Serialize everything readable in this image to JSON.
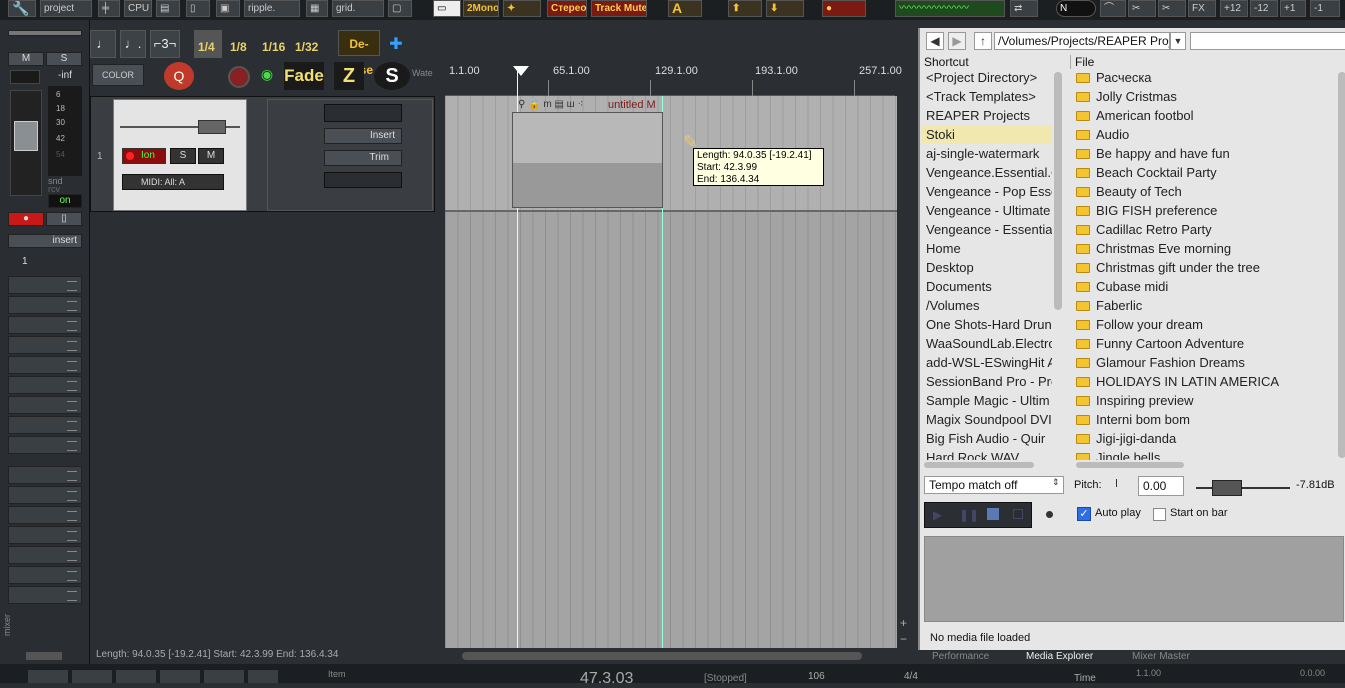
{
  "toolbar_top": {
    "project_label": "project",
    "cpu_label": "CPU",
    "ripple_label": "ripple.",
    "grid_label": "grid.",
    "mono_label": "2Mono",
    "stereo_label": "Стерео",
    "track_label": "Track Mute",
    "fx_label": "FX",
    "values": [
      "+12",
      "-12",
      "+1",
      "-1"
    ]
  },
  "mixer": {
    "m_label": "M",
    "s_label": "S",
    "inf_label": "-inf",
    "scale": [
      "6",
      "18",
      "30",
      "42",
      "54"
    ],
    "snd_label": "snd",
    "rcv_label": "rcv",
    "on_label": "on",
    "insert_label": "insert",
    "track_number": "1",
    "side_label": "mixer"
  },
  "grid_toolbar": {
    "divisions": [
      "1/4",
      "1/8",
      "1/16",
      "1/32"
    ],
    "deesser_label": "De-Esse",
    "color_label": "COLOR",
    "fade_label": "Fade",
    "z_label": "Z",
    "s_label": "S",
    "water_label": "Wate"
  },
  "track": {
    "number": "1",
    "on_label": "Ion",
    "s_label": "S",
    "m_label": "M",
    "midi_label": "MIDI: All: A",
    "insert_label": "Insert",
    "trim_label": "Trim"
  },
  "ruler": {
    "labels": [
      "1.1.00",
      "65.1.00",
      "129.1.00",
      "193.1.00",
      "257.1.00"
    ]
  },
  "item": {
    "name": "untitled M"
  },
  "tooltip": {
    "line1": "Length: 94.0.35 [-19.2.41]",
    "line2": "Start: 42.3.99",
    "line3": "End: 136.4.34"
  },
  "status": {
    "text": "Length: 94.0.35 [-19.2.41] Start: 42.3.99 End: 136.4.34"
  },
  "media_explorer": {
    "path": "/Volumes/Projects/REAPER Project",
    "shortcut_header": "Shortcut",
    "file_header": "File",
    "shortcuts": [
      "<Project Directory>",
      "<Track Templates>",
      "REAPER Projects",
      "Stoki",
      "aj-single-watermark",
      "Vengeance.Essential.C",
      "Vengeance - Pop Esse",
      "Vengeance - Ultimate",
      "Vengeance - Essentia",
      "Home",
      "Desktop",
      "Documents",
      "/Volumes",
      "One Shots-Hard Drun",
      "WaaSoundLab.Electro",
      "add-WSL-ESwingHit A",
      "SessionBand Pro - Pro",
      "Sample Magic - Ultim",
      "Magix Soundpool DVI",
      "Big Fish Audio - Quir",
      "Hard Rock WAV"
    ],
    "selected_shortcut": "Stoki",
    "files": [
      "Расческа",
      "Jolly Cristmas",
      "American footbol",
      "Audio",
      "Be happy and have fun",
      "Beach Cocktail Party",
      "Beauty of Tech",
      "BIG FISH preference",
      "Cadillac Retro Party",
      "Christmas Eve morning",
      "Christmas gift under the tree",
      "Cubase midi",
      "Faberlic",
      "Follow your dream",
      "Funny Cartoon Adventure",
      "Glamour Fashion Dreams",
      "HOLIDAYS IN LATIN AMERICA",
      "Inspiring preview",
      "Interni bom bom",
      "Jigi-jigi-danda",
      "Jingle bells"
    ],
    "tempo_option": "Tempo match off",
    "pitch_label": "Pitch:",
    "pitch_value": "0.00",
    "volume_db": "-7.81dB",
    "autoplay_label": "Auto play",
    "autoplay_checked": true,
    "start_on_bar_label": "Start on bar",
    "start_on_bar_checked": false,
    "no_media_text": "No media file loaded"
  },
  "bottom_tabs": {
    "performance": "Performance",
    "media_explorer": "Media Explorer",
    "mixer_master": "Mixer Master"
  },
  "transport": {
    "item_label": "Item",
    "time": "47.3.03",
    "stopped": "[Stopped]",
    "bpm": "106",
    "sig": "4/4",
    "time_label": "Time",
    "pos1": "1.1.00",
    "pos2": "0.0.00"
  },
  "colors": {
    "background": "#2b2f33",
    "arrange": "#a4a4a4",
    "tooltip": "#ffffe1",
    "selected_shortcut": "#f1e8b0",
    "folder": "#f2c531",
    "record": "#e02020"
  }
}
